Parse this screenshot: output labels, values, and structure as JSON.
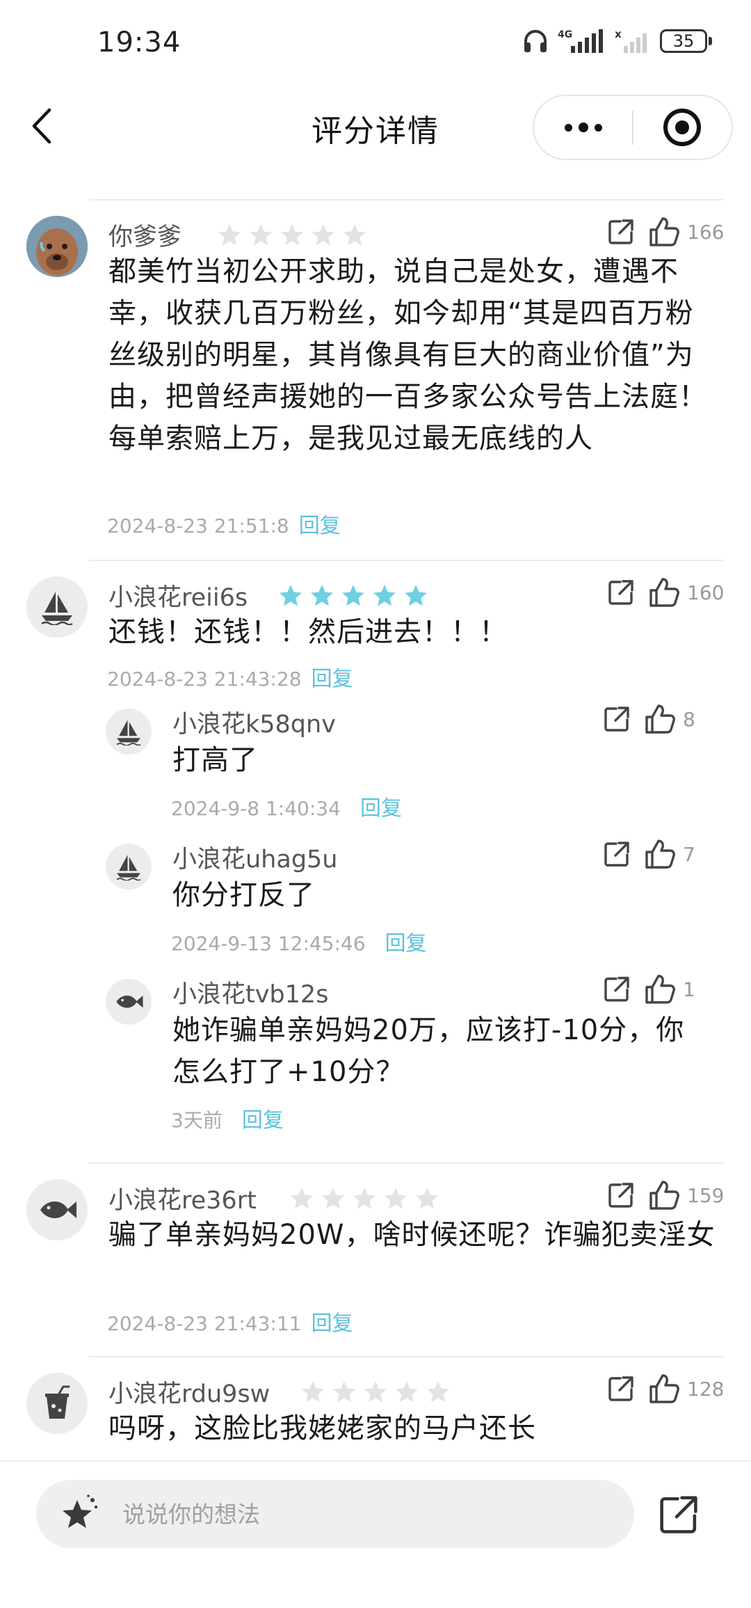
{
  "status_bar": {
    "time": "19:34",
    "network_label": "4G",
    "battery_level": "35"
  },
  "nav": {
    "title": "评分详情",
    "back_icon": "chevron-left-icon",
    "more_icon": "more-dots-icon",
    "close_icon": "target-close-icon"
  },
  "colors": {
    "reply": "#5cc2dc",
    "star_filled": "#6fd0e3",
    "star_empty": "#e3e3e3",
    "meta": "#aaaaaa"
  },
  "comments": [
    {
      "name": "你爹爹",
      "avatar": "dog-photo-avatar",
      "stars": 0,
      "likes": "166",
      "text": "都美竹当初公开求助，说自己是处女，遭遇不幸，收获几百万粉丝，如今却用“其是四百万粉丝级别的明星，其肖像具有巨大的商业价值”为由，把曾经声援她的一百多家公众号告上法庭！每单索赔上万，是我见过最无底线的人",
      "time": "2024-8-23 21:51:8",
      "reply": "回复"
    },
    {
      "name": "小浪花reii6s",
      "avatar": "sailboat-avatar",
      "stars": 5,
      "likes": "160",
      "text": "还钱！还钱！！然后进去！！！",
      "time": "2024-8-23 21:43:28",
      "reply": "回复",
      "replies": [
        {
          "name": "小浪花k58qnv",
          "avatar": "sailboat-avatar",
          "likes": "8",
          "text": "打高了",
          "time": "2024-9-8 1:40:34",
          "reply": "回复"
        },
        {
          "name": "小浪花uhag5u",
          "avatar": "sailboat-avatar",
          "likes": "7",
          "text": "你分打反了",
          "time": "2024-9-13 12:45:46",
          "reply": "回复"
        },
        {
          "name": "小浪花tvb12s",
          "avatar": "fish-avatar",
          "likes": "1",
          "text": "她诈骗单亲妈妈20万，应该打-10分，你怎么打了+10分？",
          "time": "3天前",
          "reply": "回复"
        }
      ]
    },
    {
      "name": "小浪花re36rt",
      "avatar": "fish-avatar",
      "stars": 0,
      "likes": "159",
      "text": "骗了单亲妈妈20W，啥时候还呢？诈骗犯卖淫女",
      "time": "2024-8-23 21:43:11",
      "reply": "回复"
    },
    {
      "name": "小浪花rdu9sw",
      "avatar": "drink-cup-avatar",
      "stars": 0,
      "likes": "128",
      "text": "吗呀，这脸比我姥姥家的马户还长",
      "time": "",
      "reply": ""
    }
  ],
  "bottom_bar": {
    "placeholder": "说说你的想法",
    "star_icon": "star-sparkle-icon",
    "share_icon": "share-icon"
  }
}
